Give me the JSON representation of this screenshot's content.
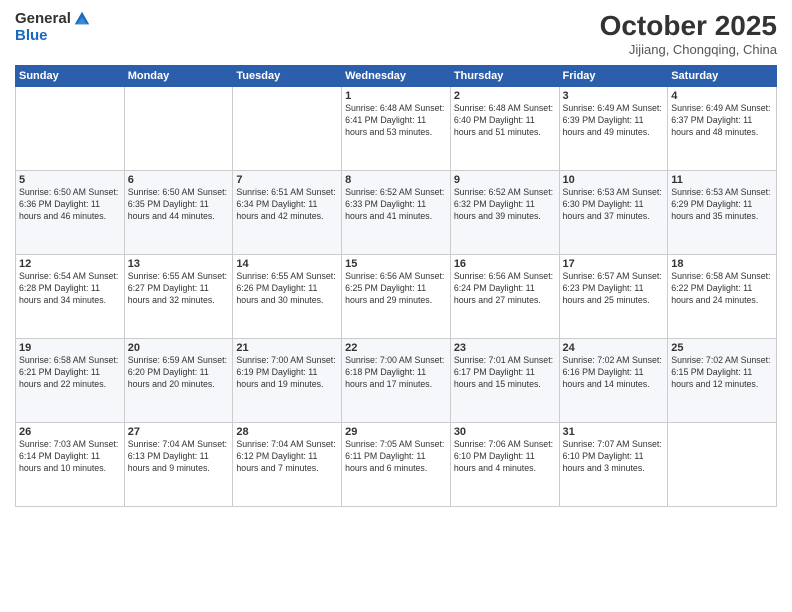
{
  "logo": {
    "general": "General",
    "blue": "Blue"
  },
  "title": "October 2025",
  "subtitle": "Jijiang, Chongqing, China",
  "headers": [
    "Sunday",
    "Monday",
    "Tuesday",
    "Wednesday",
    "Thursday",
    "Friday",
    "Saturday"
  ],
  "weeks": [
    [
      {
        "day": "",
        "info": ""
      },
      {
        "day": "",
        "info": ""
      },
      {
        "day": "",
        "info": ""
      },
      {
        "day": "1",
        "info": "Sunrise: 6:48 AM\nSunset: 6:41 PM\nDaylight: 11 hours\nand 53 minutes."
      },
      {
        "day": "2",
        "info": "Sunrise: 6:48 AM\nSunset: 6:40 PM\nDaylight: 11 hours\nand 51 minutes."
      },
      {
        "day": "3",
        "info": "Sunrise: 6:49 AM\nSunset: 6:39 PM\nDaylight: 11 hours\nand 49 minutes."
      },
      {
        "day": "4",
        "info": "Sunrise: 6:49 AM\nSunset: 6:37 PM\nDaylight: 11 hours\nand 48 minutes."
      }
    ],
    [
      {
        "day": "5",
        "info": "Sunrise: 6:50 AM\nSunset: 6:36 PM\nDaylight: 11 hours\nand 46 minutes."
      },
      {
        "day": "6",
        "info": "Sunrise: 6:50 AM\nSunset: 6:35 PM\nDaylight: 11 hours\nand 44 minutes."
      },
      {
        "day": "7",
        "info": "Sunrise: 6:51 AM\nSunset: 6:34 PM\nDaylight: 11 hours\nand 42 minutes."
      },
      {
        "day": "8",
        "info": "Sunrise: 6:52 AM\nSunset: 6:33 PM\nDaylight: 11 hours\nand 41 minutes."
      },
      {
        "day": "9",
        "info": "Sunrise: 6:52 AM\nSunset: 6:32 PM\nDaylight: 11 hours\nand 39 minutes."
      },
      {
        "day": "10",
        "info": "Sunrise: 6:53 AM\nSunset: 6:30 PM\nDaylight: 11 hours\nand 37 minutes."
      },
      {
        "day": "11",
        "info": "Sunrise: 6:53 AM\nSunset: 6:29 PM\nDaylight: 11 hours\nand 35 minutes."
      }
    ],
    [
      {
        "day": "12",
        "info": "Sunrise: 6:54 AM\nSunset: 6:28 PM\nDaylight: 11 hours\nand 34 minutes."
      },
      {
        "day": "13",
        "info": "Sunrise: 6:55 AM\nSunset: 6:27 PM\nDaylight: 11 hours\nand 32 minutes."
      },
      {
        "day": "14",
        "info": "Sunrise: 6:55 AM\nSunset: 6:26 PM\nDaylight: 11 hours\nand 30 minutes."
      },
      {
        "day": "15",
        "info": "Sunrise: 6:56 AM\nSunset: 6:25 PM\nDaylight: 11 hours\nand 29 minutes."
      },
      {
        "day": "16",
        "info": "Sunrise: 6:56 AM\nSunset: 6:24 PM\nDaylight: 11 hours\nand 27 minutes."
      },
      {
        "day": "17",
        "info": "Sunrise: 6:57 AM\nSunset: 6:23 PM\nDaylight: 11 hours\nand 25 minutes."
      },
      {
        "day": "18",
        "info": "Sunrise: 6:58 AM\nSunset: 6:22 PM\nDaylight: 11 hours\nand 24 minutes."
      }
    ],
    [
      {
        "day": "19",
        "info": "Sunrise: 6:58 AM\nSunset: 6:21 PM\nDaylight: 11 hours\nand 22 minutes."
      },
      {
        "day": "20",
        "info": "Sunrise: 6:59 AM\nSunset: 6:20 PM\nDaylight: 11 hours\nand 20 minutes."
      },
      {
        "day": "21",
        "info": "Sunrise: 7:00 AM\nSunset: 6:19 PM\nDaylight: 11 hours\nand 19 minutes."
      },
      {
        "day": "22",
        "info": "Sunrise: 7:00 AM\nSunset: 6:18 PM\nDaylight: 11 hours\nand 17 minutes."
      },
      {
        "day": "23",
        "info": "Sunrise: 7:01 AM\nSunset: 6:17 PM\nDaylight: 11 hours\nand 15 minutes."
      },
      {
        "day": "24",
        "info": "Sunrise: 7:02 AM\nSunset: 6:16 PM\nDaylight: 11 hours\nand 14 minutes."
      },
      {
        "day": "25",
        "info": "Sunrise: 7:02 AM\nSunset: 6:15 PM\nDaylight: 11 hours\nand 12 minutes."
      }
    ],
    [
      {
        "day": "26",
        "info": "Sunrise: 7:03 AM\nSunset: 6:14 PM\nDaylight: 11 hours\nand 10 minutes."
      },
      {
        "day": "27",
        "info": "Sunrise: 7:04 AM\nSunset: 6:13 PM\nDaylight: 11 hours\nand 9 minutes."
      },
      {
        "day": "28",
        "info": "Sunrise: 7:04 AM\nSunset: 6:12 PM\nDaylight: 11 hours\nand 7 minutes."
      },
      {
        "day": "29",
        "info": "Sunrise: 7:05 AM\nSunset: 6:11 PM\nDaylight: 11 hours\nand 6 minutes."
      },
      {
        "day": "30",
        "info": "Sunrise: 7:06 AM\nSunset: 6:10 PM\nDaylight: 11 hours\nand 4 minutes."
      },
      {
        "day": "31",
        "info": "Sunrise: 7:07 AM\nSunset: 6:10 PM\nDaylight: 11 hours\nand 3 minutes."
      },
      {
        "day": "",
        "info": ""
      }
    ]
  ]
}
